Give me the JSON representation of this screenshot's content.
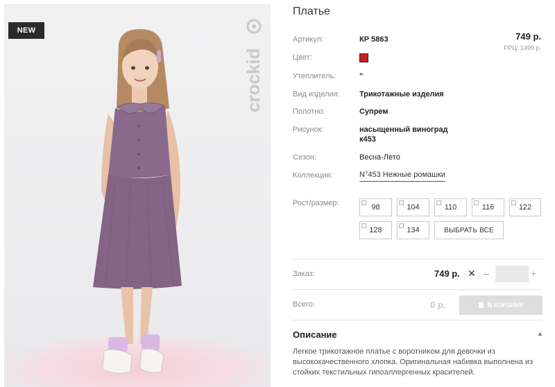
{
  "photo": {
    "badge": "NEW",
    "brand_name": "crockid",
    "alt": "Платье"
  },
  "product": {
    "title": "Платье",
    "price": "749 р.",
    "rrp": "РРЦ: 1499 р.",
    "attributes": {
      "article_label": "Артикул:",
      "article_value": "КР 5863",
      "color_label": "Цвет:",
      "color_value": "#d01d1d",
      "insulation_label": "Утеплитель:",
      "insulation_value": "\"",
      "type_label": "Вид изделия:",
      "type_value": "Трикотажные изделия",
      "fabric_label": "Полотно:",
      "fabric_value": "Супрем",
      "pattern_label": "Рисунок:",
      "pattern_line1": "насыщенный виноград",
      "pattern_line2": "к453",
      "season_label": "Сезон:",
      "season_value": "Весна-Лето",
      "collection_label": "Коллекция:",
      "collection_value": "N°453 Нежные ромашки"
    }
  },
  "sizes": {
    "label": "Рост/размер:",
    "items": [
      "98",
      "104",
      "110",
      "116",
      "122",
      "128",
      "134"
    ],
    "select_all": "ВЫБРАТЬ ВСЕ"
  },
  "order": {
    "label": "Заказ:",
    "price": "749 р.",
    "times": "✕",
    "minus": "–",
    "plus": "+",
    "quantity": ""
  },
  "total": {
    "label": "Всего:",
    "value": "0 р.",
    "cart_button": "В КОРЗИНУ"
  },
  "description": {
    "title": "Описание",
    "caret": "▲",
    "text": "Легкое трикотажное платье с воротником для девочки из высококачественного хлопка. Оригинальная набивка выполнена из стойких текстильных гипоаллергенных красителей."
  },
  "colors": {
    "dress": "#8a6a8c",
    "accent_red": "#d01d1d"
  }
}
